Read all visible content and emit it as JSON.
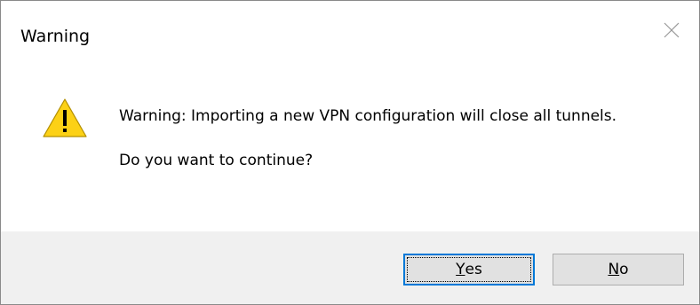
{
  "dialog": {
    "title": "Warning",
    "close_icon": "close-icon",
    "warning_icon": "warning-triangle-icon",
    "message_line": "Warning: Importing a new VPN configuration will close all tunnels.",
    "question": "Do you want to continue?"
  },
  "buttons": {
    "yes": {
      "mnemonic": "Y",
      "rest": "es"
    },
    "no": {
      "mnemonic": "N",
      "rest": "o"
    }
  },
  "colors": {
    "accent": "#0078d7",
    "footer_bg": "#f0f0f0",
    "button_bg": "#e1e1e1",
    "warning_yellow": "#fcd116"
  }
}
